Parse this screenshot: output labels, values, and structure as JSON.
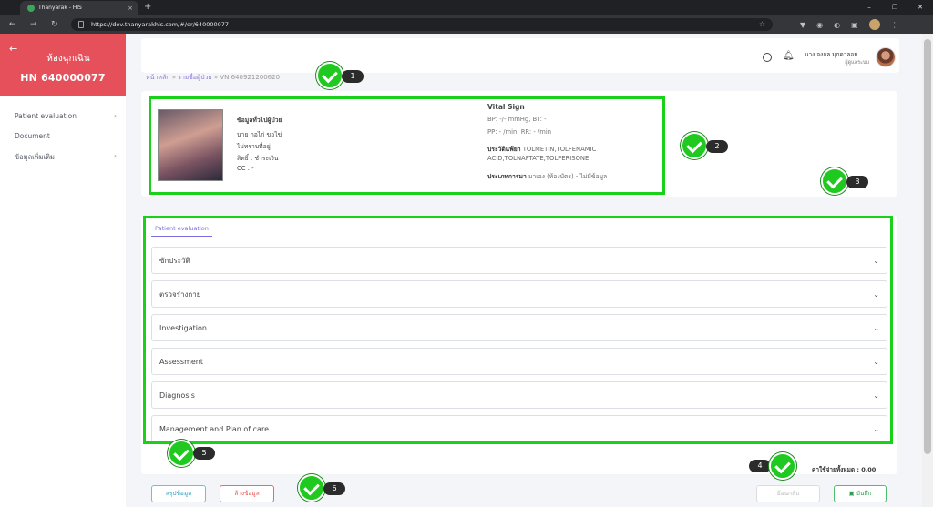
{
  "browser": {
    "tab_title": "Thanyarak - HIS",
    "tab_close": "×",
    "new_tab": "+",
    "url": "https://dev.thanyarakhis.com/#/er/640000077",
    "win_min": "–",
    "win_max": "❐",
    "win_close": "✕"
  },
  "sidebar": {
    "ward": "ห้องฉุกเฉิน",
    "hn": "HN 640000077",
    "items": [
      {
        "label": "Patient evaluation",
        "chevron": "›"
      },
      {
        "label": "Document",
        "chevron": ""
      },
      {
        "label": "ข้อมูลเพิ่มเติม",
        "chevron": "›"
      }
    ]
  },
  "header": {
    "user_name": "นาง จงกล มุกดาลอย",
    "user_role": "ผู้ดูแลระบบ"
  },
  "breadcrumb": {
    "home": "หน้าหลัก",
    "sep": "»",
    "patients": "รายชื่อผู้ป่วย",
    "current": "VN 640921200620"
  },
  "patient": {
    "section_title": "ข้อมูลทั่วไปผู้ป่วย",
    "name": "นาย กอไก่ ขอไข่",
    "address": "ไม่ทราบที่อยู่",
    "rights": "สิทธิ์ : ชำระเงิน",
    "cc": "CC : -",
    "vital_title": "Vital Sign",
    "bp_bt": "BP: -/- mmHg, BT: -",
    "pp_rr": "PP: - /min, RR: - /min",
    "allergy_label": "ประวัติแพ้ยา",
    "allergy_line1": "TOLMETIN,TOLFENAMIC",
    "allergy_line2": "ACID,TOLNAFTATE,TOLPERISONE",
    "arrival_label": "ประเภทการมา",
    "arrival_value": "มาเอง (ห้องบัตร) - ไม่มีข้อมูล"
  },
  "evaluation": {
    "tab_label": "Patient evaluation",
    "sections": [
      {
        "label": "ซักประวัติ"
      },
      {
        "label": "ตรวจร่างกาย"
      },
      {
        "label": "Investigation"
      },
      {
        "label": "Assessment"
      },
      {
        "label": "Diagnosis"
      },
      {
        "label": "Management and Plan of care"
      }
    ]
  },
  "footer": {
    "total": "ค่าใช้จ่ายทั้งหมด : 0.00",
    "summary_button": "สรุปข้อมูล",
    "clear_button": "ล้างข้อมูล",
    "back_button": "ย้อนกลับ",
    "save_button": "บันทึก"
  },
  "annotations": {
    "colors": {
      "highlight": "#19d119",
      "badge": "#2b2b2b"
    },
    "labels": [
      "1",
      "2",
      "3",
      "4",
      "5",
      "6"
    ]
  }
}
